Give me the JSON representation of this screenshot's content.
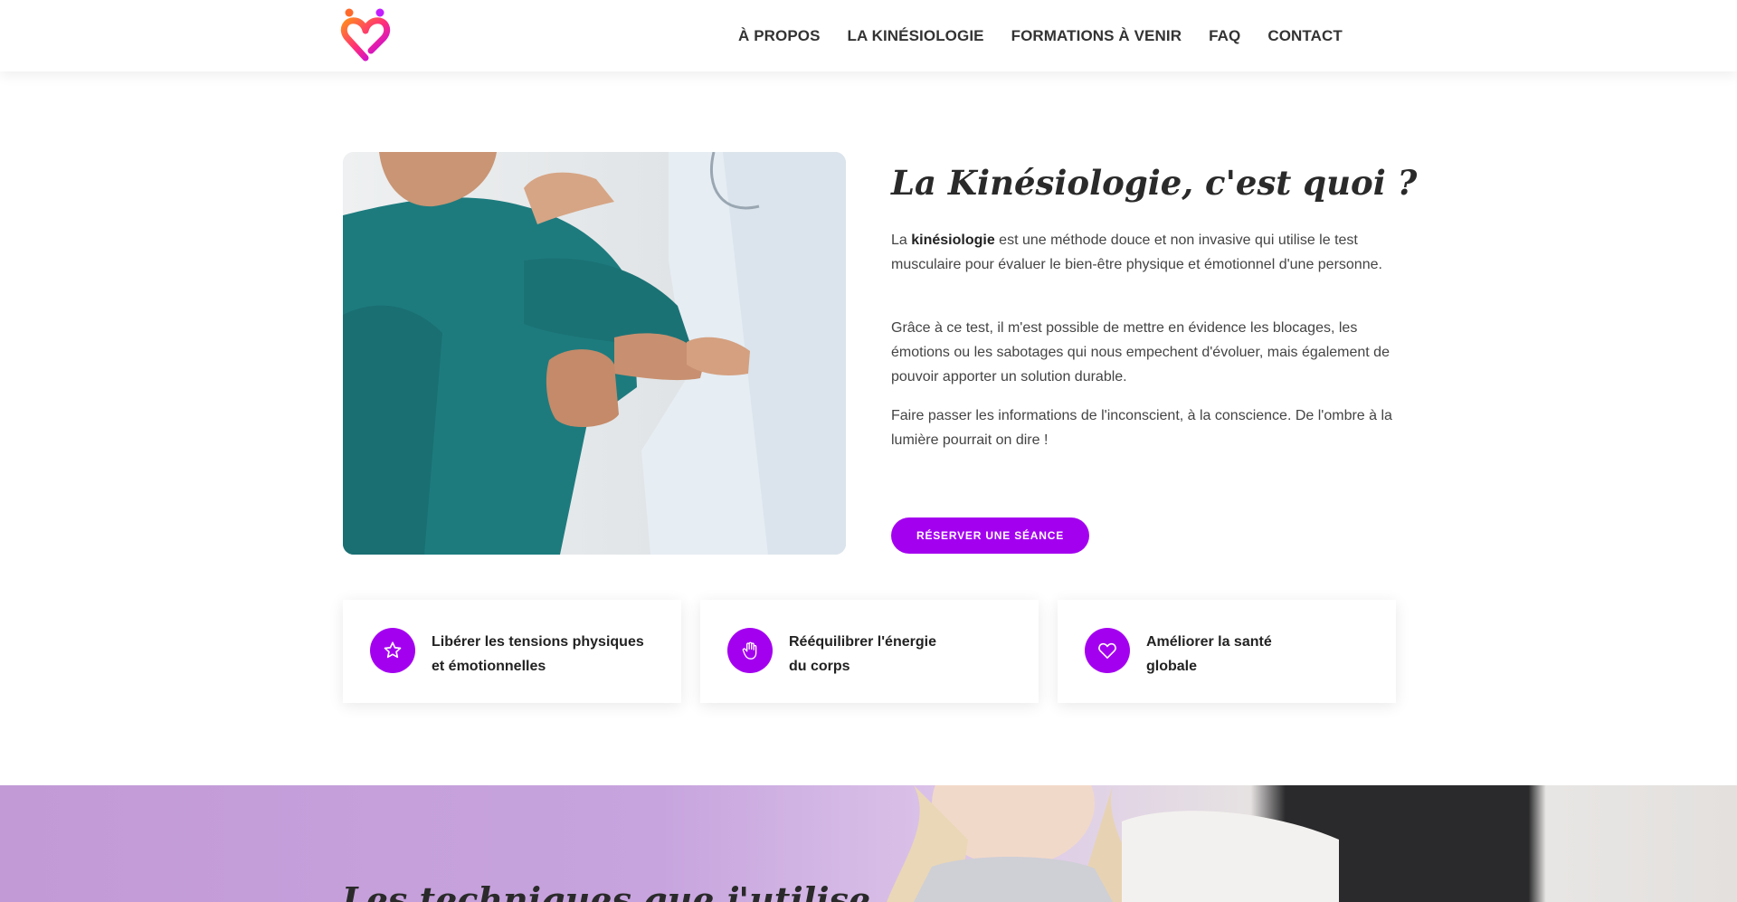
{
  "header": {
    "nav": [
      {
        "label": "À PROPOS"
      },
      {
        "label": "LA KINÉSIOLOGIE"
      },
      {
        "label": "FORMATIONS À VENIR"
      },
      {
        "label": "FAQ"
      },
      {
        "label": "CONTACT"
      }
    ]
  },
  "intro": {
    "title": "La Kinésiologie, c'est quoi ?",
    "p1_lead": "La ",
    "p1_bold": "kinésiologie",
    "p1_rest": " est une méthode douce et non invasive qui utilise le test musculaire pour évaluer le bien-être physique et émotionnel d'une personne.",
    "p2": "Grâce à ce test, il m'est possible de mettre en évidence les blocages, les émotions ou les sabotages qui nous empechent d'évoluer, mais également de pouvoir apporter un solution durable.",
    "p3": "Faire passer les informations de l'inconscient, à la conscience. De l'ombre à la lumière pourrait on dire !",
    "cta_label": "RÉSERVER UNE SÉANCE"
  },
  "features": [
    {
      "line1": "Libérer les tensions physiques",
      "line2": "et émotionnelles",
      "icon": "star-icon"
    },
    {
      "line1": "Rééquilibrer l'énergie",
      "line2": "du corps",
      "icon": "hand-icon"
    },
    {
      "line1": "Améliorer la santé",
      "line2": "globale",
      "icon": "heart-icon"
    }
  ],
  "next_section": {
    "title": "Les techniques que j'utilise"
  },
  "colors": {
    "accent": "#a400f0",
    "band": "#c29ad6"
  }
}
